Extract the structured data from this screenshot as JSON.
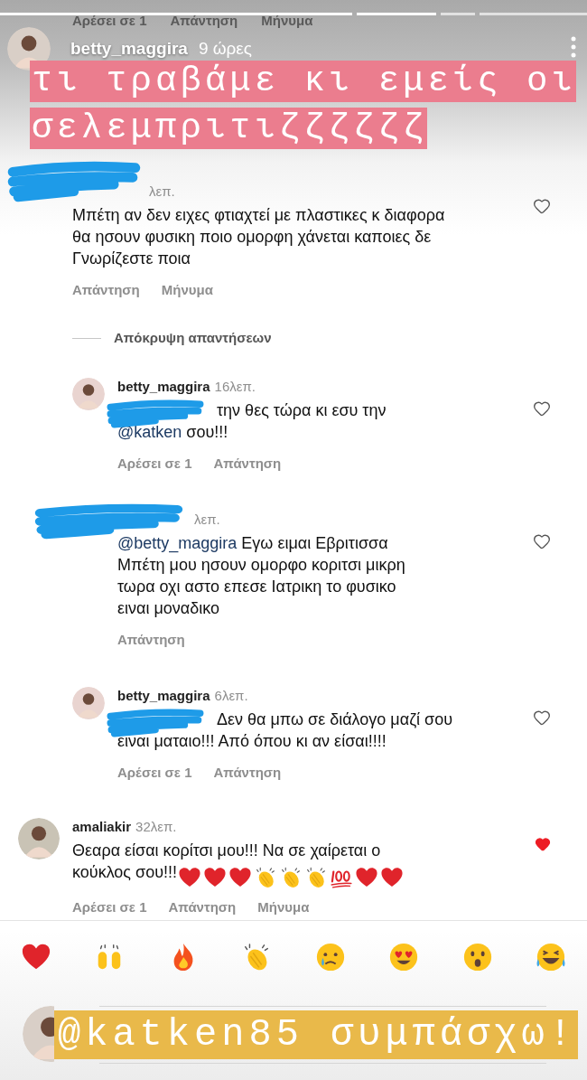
{
  "previous_actions": [
    "Αρέσει σε 1",
    "Απάντηση",
    "Μήνυμα"
  ],
  "header": {
    "username": "betty_maggira",
    "time": "9 ώρες"
  },
  "caption": {
    "lines": [
      "τι τραβάμε κι εμείς οι",
      "σελεμπριτιζζζζζζ"
    ]
  },
  "comments": [
    {
      "redacted": true,
      "time": "λεπ.",
      "body": [
        {
          "kind": "plain",
          "text": "Μπέτη αν δεν ειχες φτιαχτεί με πλαστικες κ διαφορα θα ησουν φυσικη ποιο ομορφη χάνεται καποιες δε Γνωρίζεστε ποια"
        }
      ],
      "liked": false,
      "actions": [
        "Απάντηση",
        "Μήνυμα"
      ],
      "hide_replies": "Απόκρυψη απαντήσεων",
      "children": [
        {
          "redacted": false,
          "username": "betty_maggira",
          "time": "16λεπ.",
          "prefix_redacted": true,
          "first_line": [
            {
              "kind": "plain",
              "text": "την θες τώρα κι εσυ την"
            }
          ],
          "body": [
            {
              "kind": "mention",
              "text": "@katken"
            },
            {
              "kind": "plain",
              "text": " σου!!!"
            }
          ],
          "liked": false,
          "actions": [
            "Αρέσει σε 1",
            "Απάντηση"
          ]
        },
        {
          "redacted": true,
          "time": "λεπ.",
          "body": [
            {
              "kind": "mention",
              "text": "@betty_maggira"
            },
            {
              "kind": "plain",
              "text": " Εγω ειμαι Εβριτισσα Μπέτη μου ησουν ομορφο κοριτσι μικρη τωρα οχι αστο επεσε Ιατρικη το φυσικο ειναι μοναδικο"
            }
          ],
          "liked": false,
          "actions": [
            "Απάντηση"
          ]
        },
        {
          "redacted": false,
          "username": "betty_maggira",
          "time": "6λεπ.",
          "prefix_redacted": true,
          "first_line": [
            {
              "kind": "plain",
              "text": "Δεν θα μπω σε διάλογο μαζί σου"
            }
          ],
          "body": [
            {
              "kind": "plain",
              "text": "ειναι ματαιο!!! Από όπου κι αν είσαι!!!!"
            }
          ],
          "liked": false,
          "actions": [
            "Αρέσει σε 1",
            "Απάντηση"
          ]
        }
      ]
    },
    {
      "redacted": false,
      "username": "amaliakir",
      "time": "32λεπ.",
      "body": [
        {
          "kind": "plain",
          "text": "Θεαρα είσαι κορίτσι μου!!! Να σε χαίρεται ο κούκλος σου!!!"
        }
      ],
      "emojis": [
        {
          "kind": "heart"
        },
        {
          "kind": "heart"
        },
        {
          "kind": "heart"
        },
        {
          "kind": "clap"
        },
        {
          "kind": "clap"
        },
        {
          "kind": "clap"
        },
        {
          "kind": "hundred"
        },
        {
          "kind": "heart"
        },
        {
          "kind": "heart"
        }
      ],
      "liked": true,
      "actions": [
        "Αρέσει σε 1",
        "Απάντηση",
        "Μήνυμα"
      ]
    }
  ],
  "reactions": [
    {
      "kind": "heart"
    },
    {
      "kind": "raised_hands"
    },
    {
      "kind": "fire"
    },
    {
      "kind": "clap"
    },
    {
      "kind": "crying"
    },
    {
      "kind": "heart_eyes"
    },
    {
      "kind": "surprised"
    },
    {
      "kind": "laughing"
    }
  ],
  "reply_caption": "@katken85 συμπάσχω!"
}
